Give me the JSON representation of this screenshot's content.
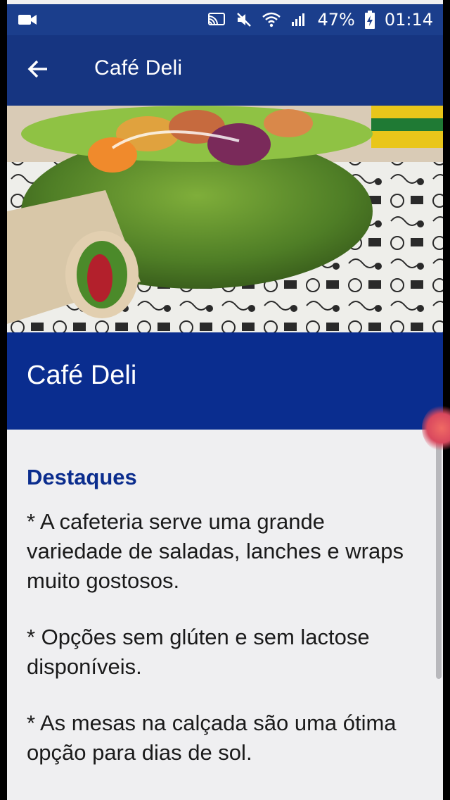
{
  "status_bar": {
    "battery": "47%",
    "time": "01:14"
  },
  "app_bar": {
    "title": "Café Deli"
  },
  "banner": {
    "title": "Café Deli"
  },
  "content": {
    "section_title": "Destaques",
    "paragraphs": [
      "* A cafeteria serve uma grande variedade de saladas, lanches e wraps muito gostosos.",
      "* Opções sem glúten e sem lactose disponíveis.",
      "* As mesas na calçada são uma ótima opção para dias de sol."
    ]
  },
  "colors": {
    "status_bar": "#1b3e8c",
    "app_bar": "#163581",
    "banner": "#0a2d8f",
    "section_title": "#0b2d8e"
  }
}
